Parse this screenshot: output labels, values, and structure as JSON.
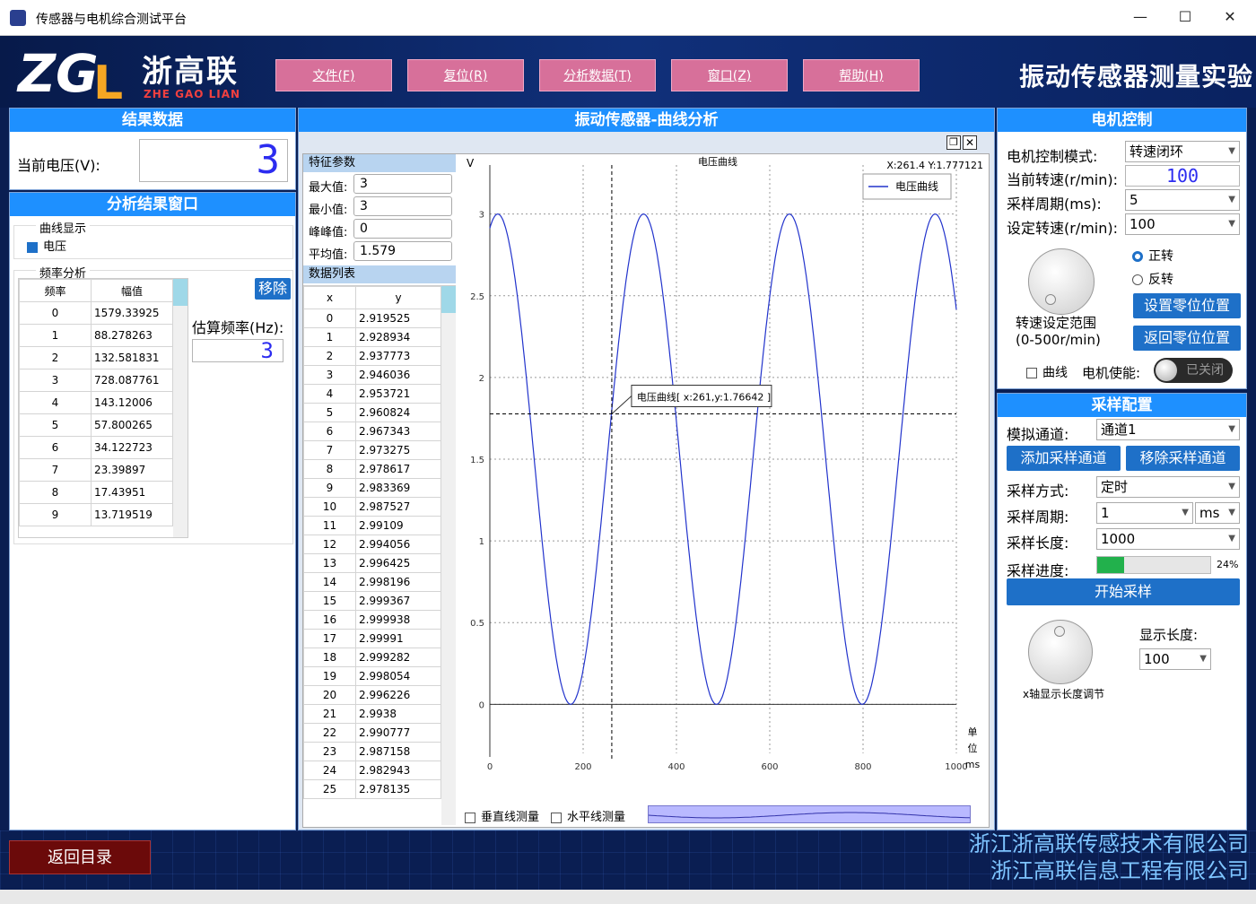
{
  "window": {
    "title": "传感器与电机综合测试平台"
  },
  "header": {
    "logo_text": "浙高联",
    "logo_pinyin": "ZHE GAO LIAN",
    "menu": [
      {
        "label": "文件(F)"
      },
      {
        "label": "复位(R)"
      },
      {
        "label": "分析数据(T)"
      },
      {
        "label": "窗口(Z)"
      },
      {
        "label": "帮助(H)"
      }
    ],
    "experiment_title": "振动传感器测量实验"
  },
  "result": {
    "title": "结果数据",
    "voltage_label": "当前电压(V):",
    "voltage_value": "3"
  },
  "analysis": {
    "title": "分析结果窗口",
    "curve_group": "曲线显示",
    "curve_voltage": "电压",
    "freq_group": "频率分析",
    "columns": [
      "频率",
      "幅值"
    ],
    "rows": [
      [
        "0",
        "1579.33925"
      ],
      [
        "1",
        "88.278263"
      ],
      [
        "2",
        "132.581831"
      ],
      [
        "3",
        "728.087761"
      ],
      [
        "4",
        "143.12006"
      ],
      [
        "5",
        "57.800265"
      ],
      [
        "6",
        "34.122723"
      ],
      [
        "7",
        "23.39897"
      ],
      [
        "8",
        "17.43951"
      ],
      [
        "9",
        "13.719519"
      ]
    ],
    "remove_label": "移除",
    "est_freq_label": "估算频率(Hz):",
    "est_freq_value": "3"
  },
  "curve": {
    "title": "振动传感器-曲线分析",
    "features_title": "特征参数",
    "features": [
      {
        "label": "最大值:",
        "value": "3"
      },
      {
        "label": "最小值:",
        "value": "3"
      },
      {
        "label": "峰峰值:",
        "value": "0"
      },
      {
        "label": "平均值:",
        "value": "1.579"
      }
    ],
    "list_title": "数据列表",
    "list_columns": [
      "x",
      "y"
    ],
    "list_rows": [
      [
        "0",
        "2.919525"
      ],
      [
        "1",
        "2.928934"
      ],
      [
        "2",
        "2.937773"
      ],
      [
        "3",
        "2.946036"
      ],
      [
        "4",
        "2.953721"
      ],
      [
        "5",
        "2.960824"
      ],
      [
        "6",
        "2.967343"
      ],
      [
        "7",
        "2.973275"
      ],
      [
        "8",
        "2.978617"
      ],
      [
        "9",
        "2.983369"
      ],
      [
        "10",
        "2.987527"
      ],
      [
        "11",
        "2.99109"
      ],
      [
        "12",
        "2.994056"
      ],
      [
        "13",
        "2.996425"
      ],
      [
        "14",
        "2.998196"
      ],
      [
        "15",
        "2.999367"
      ],
      [
        "16",
        "2.999938"
      ],
      [
        "17",
        "2.99991"
      ],
      [
        "18",
        "2.999282"
      ],
      [
        "19",
        "2.998054"
      ],
      [
        "20",
        "2.996226"
      ],
      [
        "21",
        "2.9938"
      ],
      [
        "22",
        "2.990777"
      ],
      [
        "23",
        "2.987158"
      ],
      [
        "24",
        "2.982943"
      ],
      [
        "25",
        "2.978135"
      ]
    ],
    "vline_label": "垂直线测量",
    "hline_label": "水平线测量"
  },
  "chart_data": {
    "type": "line",
    "title": "电压曲线",
    "ylabel": "V",
    "xlabel_unit": [
      "单",
      "位",
      "ms"
    ],
    "xlim": [
      0,
      1000
    ],
    "ylim": [
      -0.3,
      3.3
    ],
    "xticks": [
      0,
      200,
      400,
      600,
      800,
      1000
    ],
    "yticks": [
      0,
      0.5,
      1,
      1.5,
      2,
      2.5,
      3
    ],
    "grid": true,
    "legend": "top-right",
    "cursor_readout": "X:261.4 Y:1.777121",
    "cursor": {
      "x": 261.4,
      "y": 1.777121
    },
    "tooltip": "电压曲线[ x:261,y:1.76642 ]",
    "series": [
      {
        "name": "电压曲线",
        "color": "#2233cc",
        "function": "1.5+1.5*sin",
        "period": 312.5,
        "peak_x": 17
      }
    ]
  },
  "motor": {
    "title": "电机控制",
    "mode_label": "电机控制模式:",
    "mode_value": "转速闭环",
    "speed_label": "当前转速(r/min):",
    "speed_value": "100",
    "period_label": "采样周期(ms):",
    "period_value": "5",
    "set_speed_label": "设定转速(r/min):",
    "set_speed_value": "100",
    "forward_label": "正转",
    "reverse_label": "反转",
    "range_label_1": "转速设定范围",
    "range_label_2": "(0-500r/min)",
    "set_zero_label": "设置零位位置",
    "return_zero_label": "返回零位位置",
    "curve_label": "曲线",
    "enable_label": "电机使能:",
    "enable_state": "已关闭"
  },
  "sampling": {
    "title": "采样配置",
    "channel_label": "模拟通道:",
    "channel_value": "通道1",
    "add_channel_label": "添加采样通道",
    "remove_channel_label": "移除采样通道",
    "method_label": "采样方式:",
    "method_value": "定时",
    "period_label": "采样周期:",
    "period_value": "1",
    "period_unit": "ms",
    "length_label": "采样长度:",
    "length_value": "1000",
    "progress_label": "采样进度:",
    "progress": 0.24,
    "progress_text": "24%",
    "start_label": "开始采样",
    "xaxis_label": "x轴显示长度调节",
    "display_len_label": "显示长度:",
    "display_len_value": "100"
  },
  "footer": {
    "back_label": "返回目录",
    "company_1": "浙江浙高联传感技术有限公司",
    "company_2": "浙江高联信息工程有限公司"
  },
  "colors": {
    "accent": "#1e90ff",
    "menu": "#d7709a",
    "back": "#6b0a0a",
    "progress": "#22b14c"
  }
}
